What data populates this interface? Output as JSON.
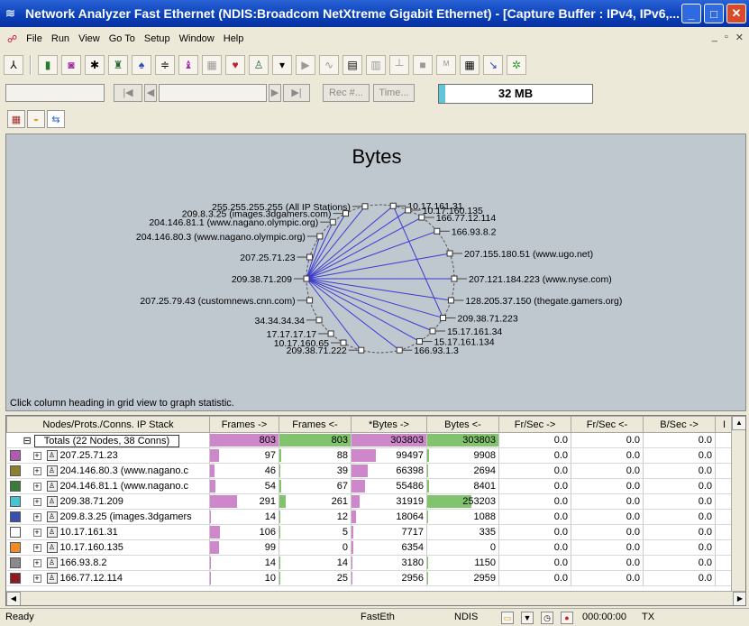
{
  "window": {
    "title": "Network Analyzer Fast Ethernet (NDIS:Broadcom NetXtreme Gigabit Ethernet) - [Capture Buffer : IPv4, IPv6,...",
    "minimize": "_",
    "maximize": "□",
    "close": "✕"
  },
  "menu": [
    "File",
    "Run",
    "View",
    "Go To",
    "Setup",
    "Window",
    "Help"
  ],
  "mdi": {
    "minimize": "_",
    "restore": "▫",
    "close": "✕"
  },
  "toolbar2": {
    "rec_label": "Rec #...",
    "time_label": "Time...",
    "memory_text": "32 MB",
    "memory_fill": 0.04
  },
  "graph": {
    "title": "Bytes",
    "hint": "Click column heading in grid view to graph statistic.",
    "labels": [
      "255.255.255.255 (All IP Stations)",
      "10.17.161.31",
      "209.8.3.25 (images.3dgamers.com)",
      "10.17.160.135",
      "204.146.81.1 (www.nagano.olympic.org)",
      "166.77.12.114",
      "204.146.80.3 (www.nagano.olympic.org)",
      "166.93.8.2",
      "207.25.71.23",
      "207.155.180.51 (www.ugo.net)",
      "209.38.71.209",
      "207.121.184.223 (www.nyse.com)",
      "207.25.79.43 (customnews.cnn.com)",
      "128.205.37.150 (thegate.gamers.org)",
      "34.34.34.34",
      "209.38.71.223",
      "17.17.17.17",
      "15.17.161.34",
      "10.17.160.65",
      "15.17.161.134",
      "209.38.71.222",
      "166.93.1.3"
    ]
  },
  "grid": {
    "headers": [
      "Nodes/Prots./Conns. IP Stack",
      "Frames ->",
      "Frames <-",
      "*Bytes ->",
      "Bytes <-",
      "Fr/Sec ->",
      "Fr/Sec <-",
      "B/Sec ->",
      "I"
    ],
    "totals": {
      "expander": "⊟",
      "label": "Totals (22 Nodes, 38 Conns)",
      "frames_out": "803",
      "frames_in": "803",
      "bytes_out": "303803",
      "bytes_in": "303803",
      "frs_out": "0.0",
      "frs_in": "0.0",
      "bs_out": "0.0"
    },
    "rows": [
      {
        "color": "#b05ab0",
        "name": "207.25.71.23",
        "frames_out": "97",
        "frames_in": "88",
        "bytes_out": "99497",
        "bytes_in": "9908",
        "frs_out": "0.0",
        "frs_in": "0.0",
        "bs_out": "0.0",
        "fo": 97,
        "fi": 88,
        "bo": 99497,
        "bi": 9908
      },
      {
        "color": "#8a8030",
        "name": "204.146.80.3 (www.nagano.c",
        "frames_out": "46",
        "frames_in": "39",
        "bytes_out": "66398",
        "bytes_in": "2694",
        "frs_out": "0.0",
        "frs_in": "0.0",
        "bs_out": "0.0",
        "fo": 46,
        "fi": 39,
        "bo": 66398,
        "bi": 2694
      },
      {
        "color": "#3d7a3d",
        "name": "204.146.81.1 (www.nagano.c",
        "frames_out": "54",
        "frames_in": "67",
        "bytes_out": "55486",
        "bytes_in": "8401",
        "frs_out": "0.0",
        "frs_in": "0.0",
        "bs_out": "0.0",
        "fo": 54,
        "fi": 67,
        "bo": 55486,
        "bi": 8401
      },
      {
        "color": "#46c4d2",
        "name": "209.38.71.209",
        "frames_out": "291",
        "frames_in": "261",
        "bytes_out": "31919",
        "bytes_in": "253203",
        "frs_out": "0.0",
        "frs_in": "0.0",
        "bs_out": "0.0",
        "fo": 291,
        "fi": 261,
        "bo": 31919,
        "bi": 253203
      },
      {
        "color": "#3a4fb0",
        "name": "209.8.3.25 (images.3dgamers",
        "frames_out": "14",
        "frames_in": "12",
        "bytes_out": "18064",
        "bytes_in": "1088",
        "frs_out": "0.0",
        "frs_in": "0.0",
        "bs_out": "0.0",
        "fo": 14,
        "fi": 12,
        "bo": 18064,
        "bi": 1088
      },
      {
        "color": "#ffffff",
        "name": "10.17.161.31",
        "frames_out": "106",
        "frames_in": "5",
        "bytes_out": "7717",
        "bytes_in": "335",
        "frs_out": "0.0",
        "frs_in": "0.0",
        "bs_out": "0.0",
        "fo": 106,
        "fi": 5,
        "bo": 7717,
        "bi": 335
      },
      {
        "color": "#f08a2a",
        "name": "10.17.160.135",
        "frames_out": "99",
        "frames_in": "0",
        "bytes_out": "6354",
        "bytes_in": "0",
        "frs_out": "0.0",
        "frs_in": "0.0",
        "bs_out": "0.0",
        "fo": 99,
        "fi": 0,
        "bo": 6354,
        "bi": 0
      },
      {
        "color": "#8a8a8a",
        "name": "166.93.8.2",
        "frames_out": "14",
        "frames_in": "14",
        "bytes_out": "3180",
        "bytes_in": "1150",
        "frs_out": "0.0",
        "frs_in": "0.0",
        "bs_out": "0.0",
        "fo": 14,
        "fi": 14,
        "bo": 3180,
        "bi": 1150
      },
      {
        "color": "#8a1c24",
        "name": "166.77.12.114",
        "frames_out": "10",
        "frames_in": "25",
        "bytes_out": "2956",
        "bytes_in": "2959",
        "frs_out": "0.0",
        "frs_in": "0.0",
        "bs_out": "0.0",
        "fo": 10,
        "fi": 25,
        "bo": 2956,
        "bi": 2959
      }
    ]
  },
  "status": {
    "ready": "Ready",
    "adapter": "FastEth",
    "driver": "NDIS",
    "elapsed": "000:00:00",
    "mode": "TX"
  }
}
